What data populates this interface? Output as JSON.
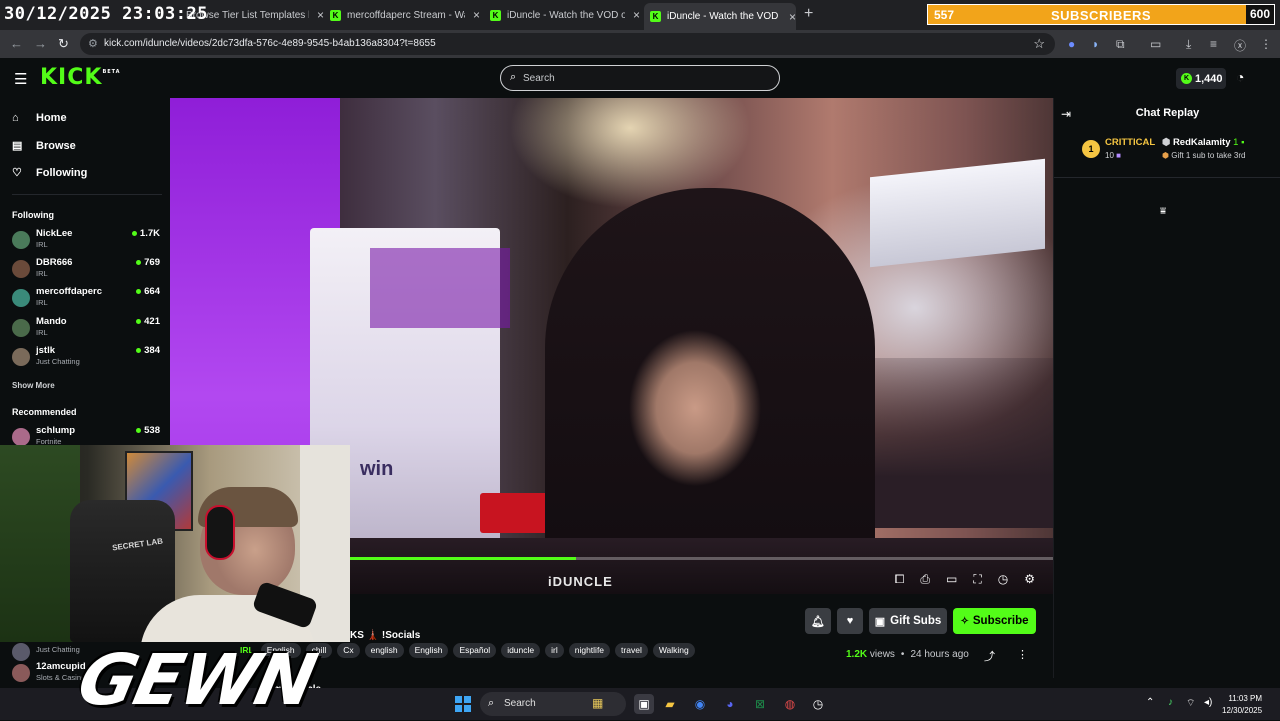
{
  "overlay": {
    "clock": "30/12/2025 23:03:25",
    "sub_goal": {
      "current": "557",
      "label": "SUBSCRIBERS",
      "target": "600",
      "progress": 0.928
    },
    "brand": "GEWN"
  },
  "browser": {
    "tabs": [
      {
        "title": "Browse Tier List Templates by C",
        "close": "×"
      },
      {
        "title": "mercoffdaperc Stream - Watch",
        "close": "×"
      },
      {
        "title": "iDuncle - Watch the VOD on Ki",
        "close": "×"
      },
      {
        "title": "iDuncle - Watch the VOD on Ki",
        "close": "×"
      }
    ],
    "new_tab": "+",
    "url": "kick.com/iduncle/videos/2dc73dfa-576c-4e89-9545-b4ab136a8304?t=8655"
  },
  "header": {
    "logo": "KICK",
    "logo_badge": "BETA",
    "search_placeholder": "Search",
    "kicks_balance": "1,440"
  },
  "sidebar": {
    "nav": [
      {
        "label": "Home",
        "icon": "home-icon"
      },
      {
        "label": "Browse",
        "icon": "browse-icon"
      },
      {
        "label": "Following",
        "icon": "heart-icon"
      }
    ],
    "following_title": "Following",
    "following": [
      {
        "name": "NickLee",
        "category": "IRL",
        "viewers": "1.7K",
        "avatar": "#4a7a5a"
      },
      {
        "name": "DBR666",
        "category": "IRL",
        "viewers": "769",
        "avatar": "#6a4a3a"
      },
      {
        "name": "mercoffdaperc",
        "category": "IRL",
        "viewers": "664",
        "avatar": "#3a8a7a"
      },
      {
        "name": "Mando",
        "category": "IRL",
        "viewers": "421",
        "avatar": "#4a6a4a"
      },
      {
        "name": "jstlk",
        "category": "Just Chatting",
        "viewers": "384",
        "avatar": "#7a6a5a"
      }
    ],
    "show_more": "Show More",
    "recommended_title": "Recommended",
    "recommended": [
      {
        "name": "schlump",
        "category": "Fortnite",
        "viewers": "538",
        "avatar": "#aa6a8a"
      }
    ],
    "below_cam": [
      {
        "name": "",
        "category": "Just Chatting",
        "viewers": "",
        "avatar": "#5a5a6a"
      },
      {
        "name": "12amcupid",
        "category": "Slots & Casino",
        "viewers": "",
        "avatar": "#8a5a5a"
      }
    ]
  },
  "video": {
    "progress": 0.46,
    "watermark": "iDUNCLE",
    "chair_logo": "SECRET LAB",
    "claw_machine_text": "win"
  },
  "info": {
    "title_visible": "KS 🗼 !Socials",
    "tags": [
      "IRL",
      "English",
      "chill",
      "Cx",
      "english",
      "English",
      "Español",
      "iduncle",
      "irl",
      "nightlife",
      "travel",
      "Walking"
    ],
    "about_partial": "from iDuncle",
    "views": "1.2K",
    "views_label": "views",
    "age": "24 hours ago",
    "gift_subs": "Gift Subs",
    "subscribe": "Subscribe"
  },
  "chat": {
    "title": "Chat Replay",
    "leaderboard_rank": "1",
    "gifters": [
      {
        "name": "CRITTICAL",
        "sub": "10",
        "color": "#f5c542"
      },
      {
        "name": "RedKalamity",
        "count": "1",
        "sub": "Gift 1 sub to take 3rd",
        "color": "#ffffff"
      }
    ]
  },
  "taskbar": {
    "search": "Search",
    "time": "11:03 PM",
    "date": "12/30/2025"
  }
}
